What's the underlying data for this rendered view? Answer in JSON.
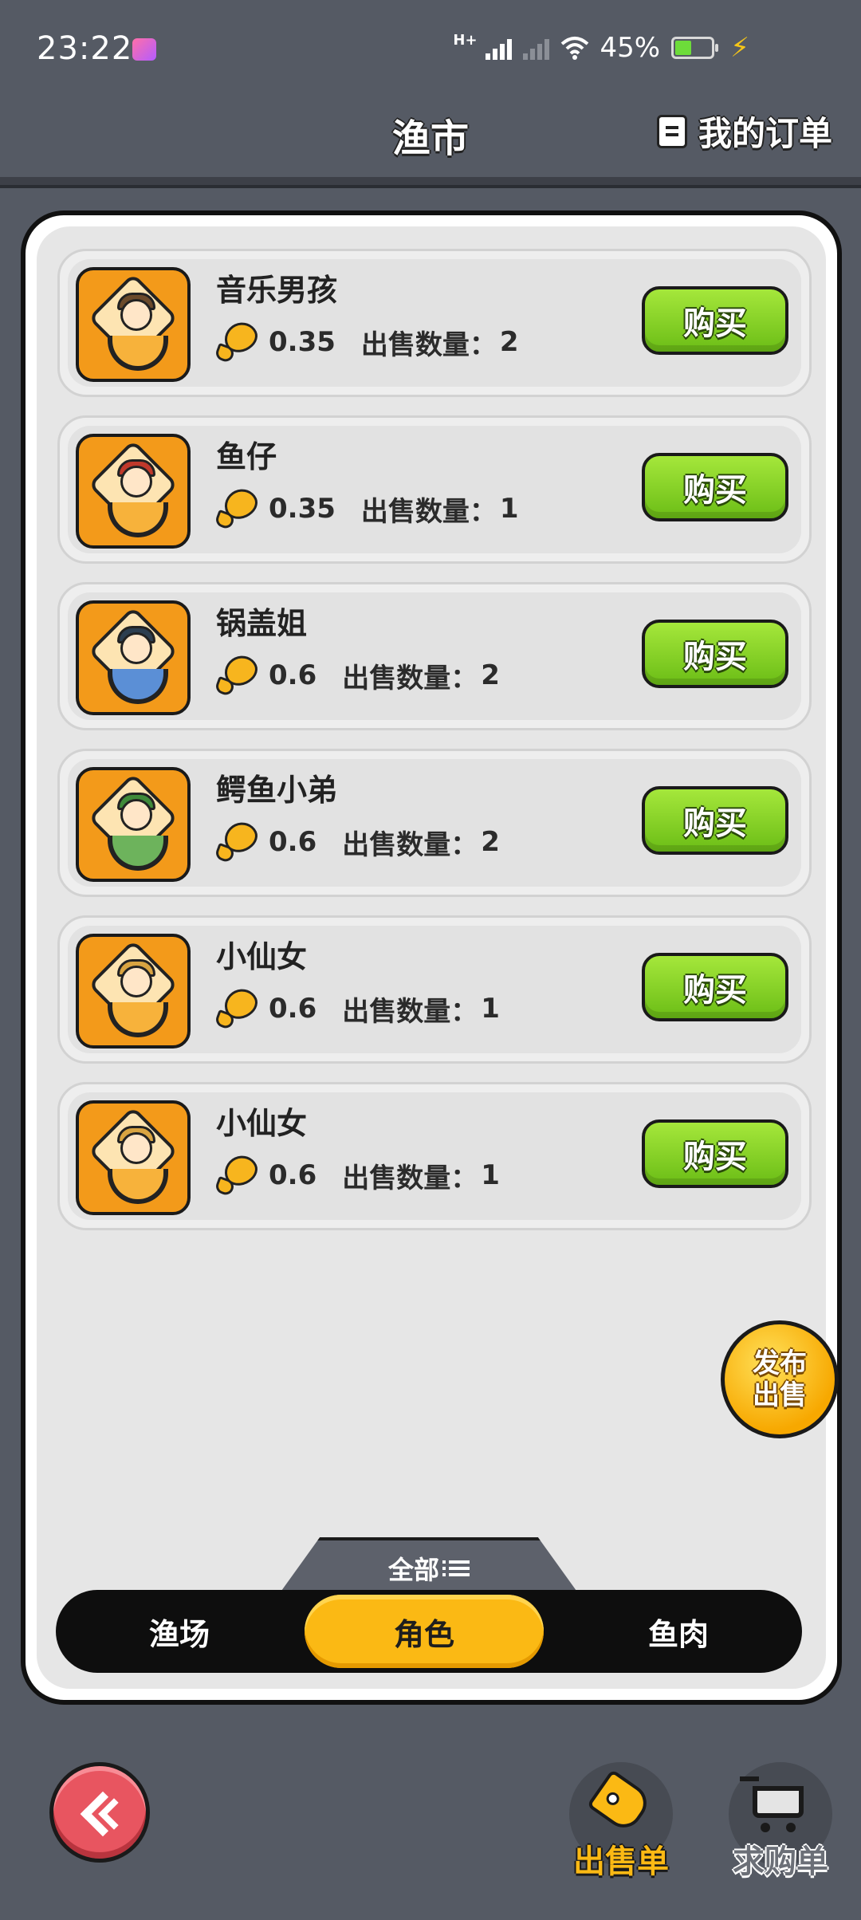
{
  "status_bar": {
    "time": "23:22",
    "network": "H+",
    "battery": "45%"
  },
  "header": {
    "title": "渔市",
    "orders_link": "我的订单"
  },
  "items": [
    {
      "name": "音乐男孩",
      "price": "0.35",
      "qty_label": "出售数量：",
      "qty": "2",
      "buy_label": "购买"
    },
    {
      "name": "鱼仔",
      "price": "0.35",
      "qty_label": "出售数量：",
      "qty": "1",
      "buy_label": "购买"
    },
    {
      "name": "锅盖姐",
      "price": "0.6",
      "qty_label": "出售数量：",
      "qty": "2",
      "buy_label": "购买"
    },
    {
      "name": "鳄鱼小弟",
      "price": "0.6",
      "qty_label": "出售数量：",
      "qty": "2",
      "buy_label": "购买"
    },
    {
      "name": "小仙女",
      "price": "0.6",
      "qty_label": "出售数量：",
      "qty": "1",
      "buy_label": "购买"
    },
    {
      "name": "小仙女",
      "price": "0.6",
      "qty_label": "出售数量：",
      "qty": "1",
      "buy_label": "购买"
    }
  ],
  "filter": {
    "label": "全部"
  },
  "segments": {
    "selected": "角色",
    "items": [
      {
        "label": "渔场"
      },
      {
        "label": "角色"
      },
      {
        "label": "鱼肉"
      }
    ]
  },
  "publish_button": {
    "line1": "发布",
    "line2": "出售"
  },
  "bottom_nav": {
    "sell_list": "出售单",
    "buy_list": "求购单"
  },
  "colors": {
    "background": "#555a64",
    "accent_yellow": "#fbb914",
    "buy_green": "#7ccf1f",
    "back_red": "#e85560",
    "avatar_orange": "#f39a1a"
  },
  "icons": {
    "currency": "fish-coin-icon",
    "orders": "document-icon",
    "filter": "list-icon",
    "back": "back-arrow-icon",
    "sell": "tag-icon",
    "buy": "cart-icon"
  }
}
